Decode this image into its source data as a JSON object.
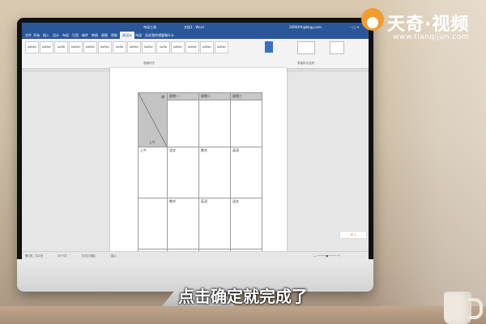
{
  "word": {
    "title_left": "布局工具",
    "title_center": "文档1 - Word",
    "account": "2696##@bkgy.com",
    "tabs": [
      "文件",
      "开始",
      "插入",
      "设计",
      "布局",
      "引用",
      "邮件",
      "审阅",
      "视图",
      "帮助",
      "表设计",
      "布局",
      "告诉我你想要做什么"
    ],
    "active_tab_index": 1,
    "styles": [
      "AaBbC",
      "AaBbC",
      "AaBb",
      "AaBbC",
      "AaBbC",
      "AaBbC",
      "AaBb",
      "AaBbC",
      "AaBbC",
      "AaBb",
      "AaBbC",
      "AaBbC",
      "AaBbC",
      "AaBbC"
    ],
    "group_styles": "表格样式",
    "group_options": "表格样式选项",
    "status_page": "第1页，共1页",
    "status_words": "20个字",
    "status_lang": "中文(中国)",
    "status_mode": "插入",
    "tray_label": "中 ·)"
  },
  "schedule": {
    "diag_top": "课",
    "diag_bottom": "上午",
    "headers": [
      "星期一",
      "星期二",
      "星期三"
    ],
    "rows": [
      [
        "上午",
        "语文",
        "数学",
        "英语"
      ],
      [
        "",
        "数学",
        "英语",
        "语文"
      ],
      [
        "",
        "",
        "",
        ""
      ]
    ]
  },
  "logo": {
    "name": "天奇·视频",
    "url": "www.tianqijun.com"
  },
  "subtitle": "点击确定就完成了"
}
